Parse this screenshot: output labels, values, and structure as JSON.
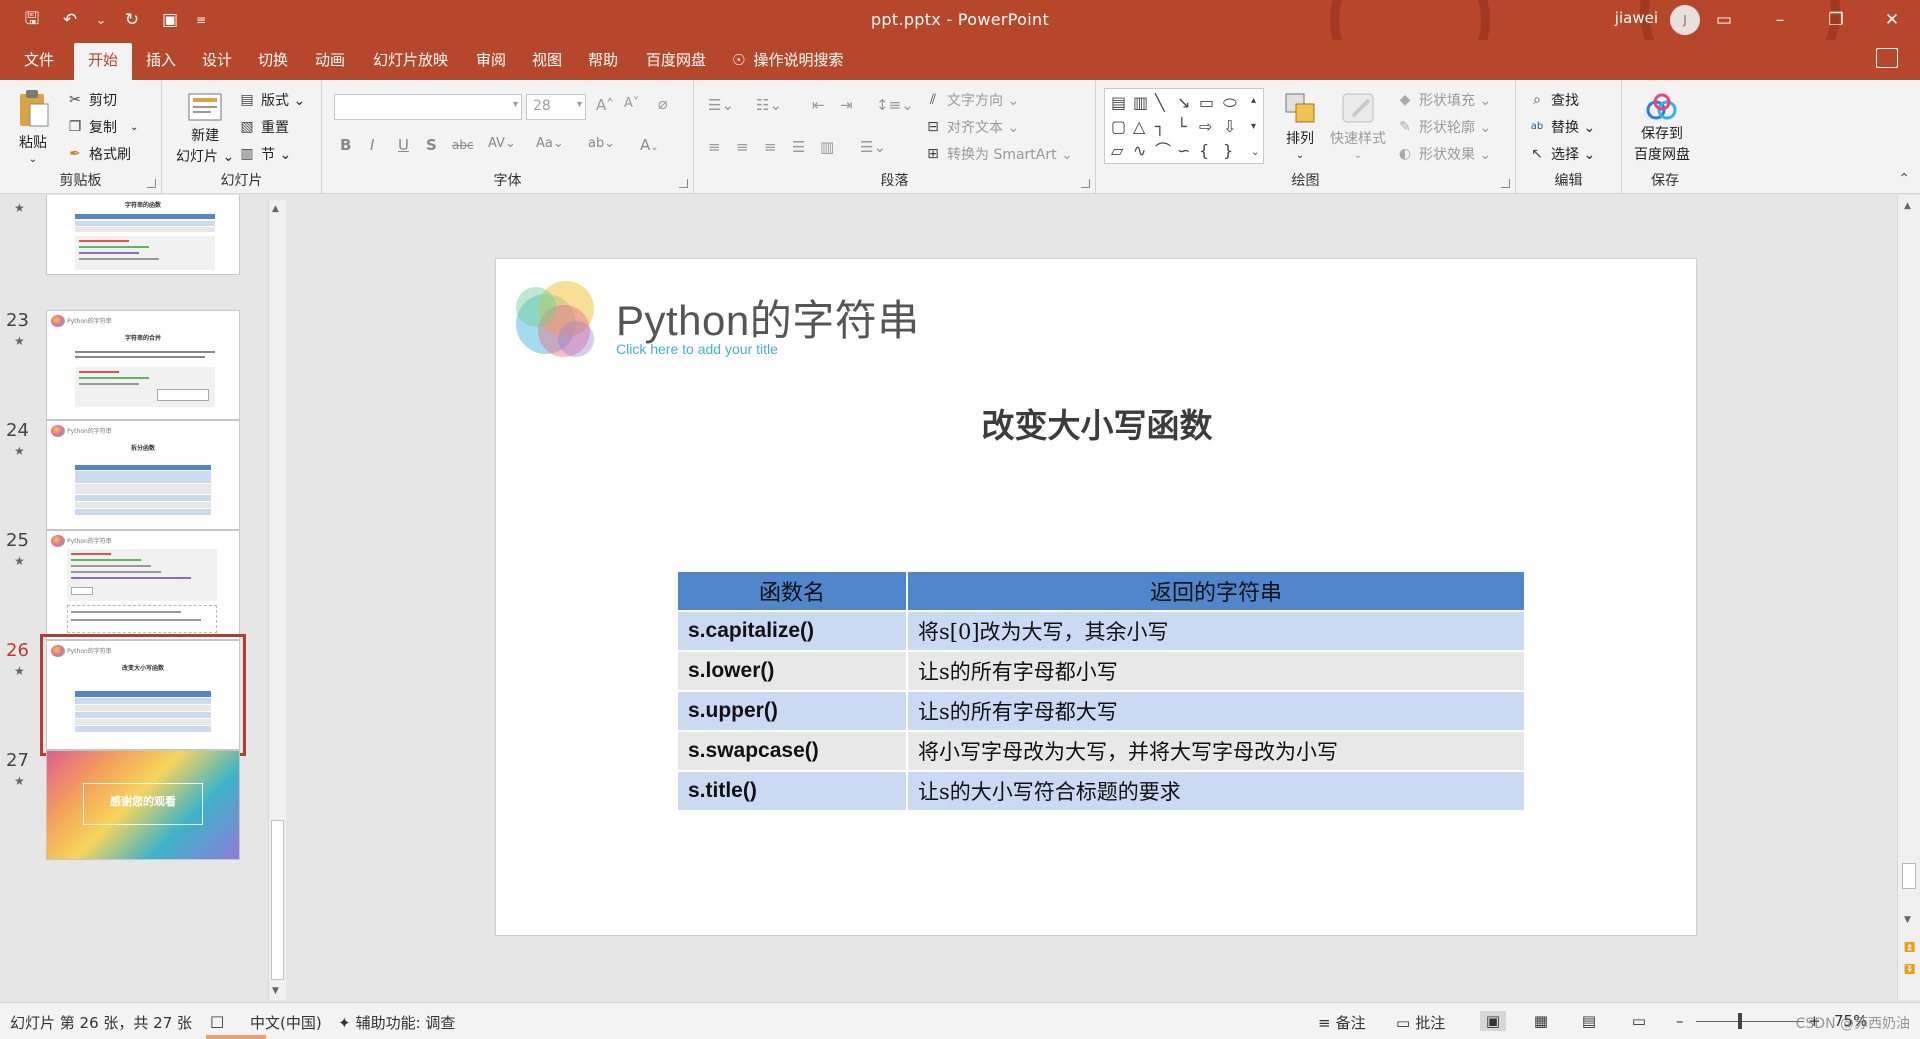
{
  "window": {
    "doc_title": "ppt.pptx  -  PowerPoint",
    "user_name": "jiawei",
    "avatar_initial": "J"
  },
  "tabs": [
    "文件",
    "开始",
    "插入",
    "设计",
    "切换",
    "动画",
    "幻灯片放映",
    "审阅",
    "视图",
    "帮助",
    "百度网盘"
  ],
  "active_tab": "开始",
  "tell_me": "操作说明搜索",
  "ribbon": {
    "clipboard": {
      "label": "剪贴板",
      "paste": "粘贴",
      "cut": "剪切",
      "copy": "复制",
      "format_painter": "格式刷"
    },
    "slides": {
      "label": "幻灯片",
      "new_slide_line1": "新建",
      "new_slide_line2": "幻灯片 ⌄",
      "layout": "版式 ⌄",
      "reset": "重置",
      "section": "节 ⌄"
    },
    "font": {
      "label": "字体",
      "font_size": "28"
    },
    "paragraph": {
      "label": "段落",
      "text_direction": "文字方向 ⌄",
      "align_text": "对齐文本 ⌄",
      "smartart": "转换为 SmartArt ⌄"
    },
    "drawing": {
      "label": "绘图",
      "arrange": "排列",
      "quick_styles": "快速样式",
      "shape_fill": "形状填充 ⌄",
      "shape_outline": "形状轮廓 ⌄",
      "shape_effects": "形状效果 ⌄"
    },
    "editing": {
      "label": "编辑",
      "find": "查找",
      "replace": "替换 ⌄",
      "select": "选择 ⌄"
    },
    "save": {
      "label": "保存",
      "save_line1": "保存到",
      "save_line2": "百度网盘"
    }
  },
  "thumbnails": [
    {
      "num": "",
      "title": "字符串的函数"
    },
    {
      "num": "23",
      "header": "Python的字符串",
      "title": "字符串的合并"
    },
    {
      "num": "24",
      "header": "Python的字符串",
      "title": "拆分函数"
    },
    {
      "num": "25",
      "header": "Python的字符串",
      "title": ""
    },
    {
      "num": "26",
      "header": "Python的字符串",
      "title": "改变大小写函数"
    },
    {
      "num": "27",
      "title": "感谢您的观看"
    }
  ],
  "slide": {
    "header": "Python的字符串",
    "subtitle_placeholder": "Click here to add your title",
    "title": "改变大小写函数",
    "table": {
      "headers": [
        "函数名",
        "返回的字符串"
      ],
      "rows": [
        [
          "s.capitalize()",
          "将s[0]改为大写，其余小写"
        ],
        [
          "s.lower()",
          "让s的所有字母都小写"
        ],
        [
          "s.upper()",
          "让s的所有字母都大写"
        ],
        [
          "s.swapcase()",
          "将小写字母改为大写，并将大写字母改为小写"
        ],
        [
          "s.title()",
          "让s的大小写符合标题的要求"
        ]
      ]
    }
  },
  "status": {
    "slide_info": "幻灯片 第 26 张，共 27 张",
    "language": "中文(中国)",
    "accessibility": "辅助功能: 调查",
    "notes": "备注",
    "comments": "批注",
    "zoom": "75%",
    "watermark": "CSDN @苏西奶油"
  },
  "colors": {
    "brand": "#b7472a",
    "table_header": "#4f86cc",
    "table_row_odd": "#c9daf2",
    "table_row_even": "#e8e8e8",
    "selected_thumb": "#b83c2c"
  }
}
